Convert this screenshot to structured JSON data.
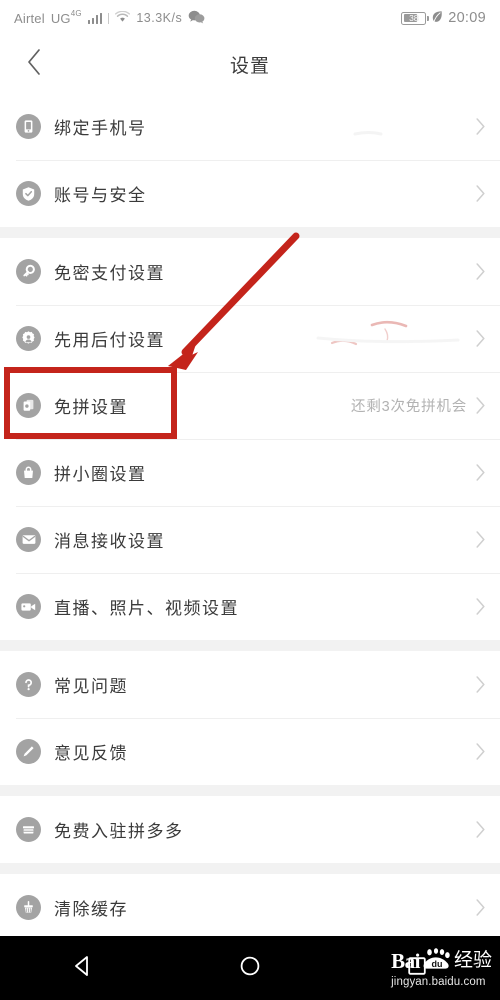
{
  "statusbar": {
    "carrier": "Airtel",
    "network_label": "UG",
    "network_sup": "4G",
    "signal_icon": "signal-bars-icon",
    "wifi_icon": "wifi-icon",
    "data_speed": "13.3K/s",
    "wechat_icon": "wechat-icon",
    "battery_level": "38",
    "battery_icon": "battery-icon",
    "power_save_icon": "leaf-icon",
    "clock": "20:09"
  },
  "titlebar": {
    "back_icon": "back-chevron-icon",
    "title": "设置"
  },
  "groups": [
    {
      "rows": [
        {
          "icon": "phone-icon",
          "label": "绑定手机号",
          "value": "",
          "value_faint": true,
          "chevron": "chevron-right-icon"
        },
        {
          "icon": "shield-check-icon",
          "label": "账号与安全",
          "value": "",
          "value_faint": false,
          "chevron": "chevron-right-icon"
        }
      ]
    },
    {
      "rows": [
        {
          "icon": "key-icon",
          "label": "免密支付设置",
          "value": "",
          "value_faint": false,
          "chevron": "chevron-right-icon"
        },
        {
          "icon": "gear-person-icon",
          "label": "先用后付设置",
          "value": "",
          "value_faint": false,
          "chevron": "chevron-right-icon"
        },
        {
          "icon": "cards-icon",
          "label": "免拼设置",
          "value": "还剩3次免拼机会",
          "value_faint": false,
          "chevron": "chevron-right-icon",
          "highlighted": true
        },
        {
          "icon": "bag-lock-icon",
          "label": "拼小圈设置",
          "value": "",
          "value_faint": false,
          "chevron": "chevron-right-icon"
        },
        {
          "icon": "envelope-icon",
          "label": "消息接收设置",
          "value": "",
          "value_faint": false,
          "chevron": "chevron-right-icon"
        },
        {
          "icon": "video-camera-icon",
          "label": "直播、照片、视频设置",
          "value": "",
          "value_faint": false,
          "chevron": "chevron-right-icon"
        }
      ]
    },
    {
      "rows": [
        {
          "icon": "question-mark-icon",
          "label": "常见问题",
          "value": "",
          "value_faint": false,
          "chevron": "chevron-right-icon"
        },
        {
          "icon": "pencil-icon",
          "label": "意见反馈",
          "value": "",
          "value_faint": false,
          "chevron": "chevron-right-icon"
        }
      ]
    },
    {
      "rows": [
        {
          "icon": "storefront-icon",
          "label": "免费入驻拼多多",
          "value": "",
          "value_faint": false,
          "chevron": "chevron-right-icon"
        }
      ]
    },
    {
      "rows": [
        {
          "icon": "broom-icon",
          "label": "清除缓存",
          "value": "",
          "value_faint": false,
          "chevron": "chevron-right-icon"
        }
      ]
    }
  ],
  "annotation": {
    "highlight_color": "#C4241B",
    "arrow_icon": "red-arrow-icon",
    "box_icon": "red-highlight-box",
    "target_label": "免拼设置"
  },
  "navbar": {
    "back_icon": "triangle-back-icon",
    "home_icon": "circle-home-icon",
    "recents_icon": "square-recents-icon"
  },
  "watermark": {
    "brand": "Bai",
    "brand_suffix": "du",
    "product": "经验",
    "url": "jingyan.baidu.com"
  }
}
